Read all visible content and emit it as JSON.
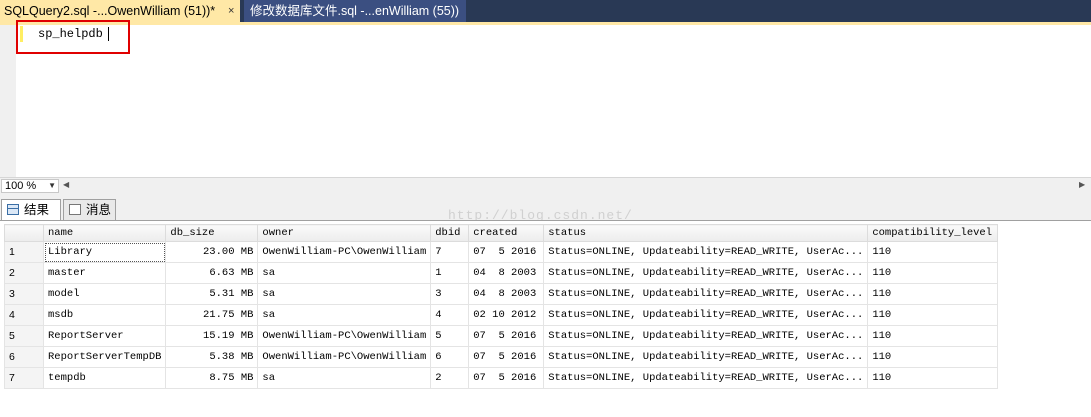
{
  "tabs": [
    {
      "label": "SQLQuery2.sql -...OwenWilliam (51))*",
      "active": true
    },
    {
      "label": "修改数据库文件.sql -...enWilliam (55))",
      "active": false
    }
  ],
  "tab_close_glyph": "×",
  "editor": {
    "text": "sp_helpdb"
  },
  "zoom": {
    "value": "100 %"
  },
  "result_tabs": {
    "results": "结果",
    "messages": "消息"
  },
  "watermark": "http://blog.csdn.net/",
  "grid": {
    "columns": [
      "name",
      "db_size",
      "owner",
      "dbid",
      "created",
      "status",
      "compatibility_level"
    ],
    "rows": [
      {
        "rn": "1",
        "name": "Library",
        "db_size": "23.00 MB",
        "owner": "OwenWilliam-PC\\OwenWilliam",
        "dbid": "7",
        "created": "07  5 2016",
        "status": "Status=ONLINE, Updateability=READ_WRITE, UserAc...",
        "compatibility_level": "110"
      },
      {
        "rn": "2",
        "name": "master",
        "db_size": "6.63 MB",
        "owner": "sa",
        "dbid": "1",
        "created": "04  8 2003",
        "status": "Status=ONLINE, Updateability=READ_WRITE, UserAc...",
        "compatibility_level": "110"
      },
      {
        "rn": "3",
        "name": "model",
        "db_size": "5.31 MB",
        "owner": "sa",
        "dbid": "3",
        "created": "04  8 2003",
        "status": "Status=ONLINE, Updateability=READ_WRITE, UserAc...",
        "compatibility_level": "110"
      },
      {
        "rn": "4",
        "name": "msdb",
        "db_size": "21.75 MB",
        "owner": "sa",
        "dbid": "4",
        "created": "02 10 2012",
        "status": "Status=ONLINE, Updateability=READ_WRITE, UserAc...",
        "compatibility_level": "110"
      },
      {
        "rn": "5",
        "name": "ReportServer",
        "db_size": "15.19 MB",
        "owner": "OwenWilliam-PC\\OwenWilliam",
        "dbid": "5",
        "created": "07  5 2016",
        "status": "Status=ONLINE, Updateability=READ_WRITE, UserAc...",
        "compatibility_level": "110"
      },
      {
        "rn": "6",
        "name": "ReportServerTempDB",
        "db_size": "5.38 MB",
        "owner": "OwenWilliam-PC\\OwenWilliam",
        "dbid": "6",
        "created": "07  5 2016",
        "status": "Status=ONLINE, Updateability=READ_WRITE, UserAc...",
        "compatibility_level": "110"
      },
      {
        "rn": "7",
        "name": "tempdb",
        "db_size": "8.75 MB",
        "owner": "sa",
        "dbid": "2",
        "created": "07  5 2016",
        "status": "Status=ONLINE, Updateability=READ_WRITE, UserAc...",
        "compatibility_level": "110"
      }
    ]
  }
}
